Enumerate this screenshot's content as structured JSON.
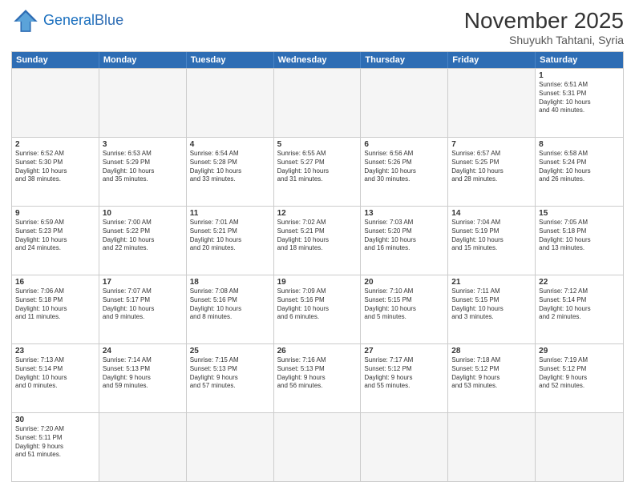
{
  "header": {
    "logo_general": "General",
    "logo_blue": "Blue",
    "month_title": "November 2025",
    "subtitle": "Shuyukh Tahtani, Syria"
  },
  "weekdays": [
    "Sunday",
    "Monday",
    "Tuesday",
    "Wednesday",
    "Thursday",
    "Friday",
    "Saturday"
  ],
  "rows": [
    [
      {
        "day": "",
        "info": ""
      },
      {
        "day": "",
        "info": ""
      },
      {
        "day": "",
        "info": ""
      },
      {
        "day": "",
        "info": ""
      },
      {
        "day": "",
        "info": ""
      },
      {
        "day": "",
        "info": ""
      },
      {
        "day": "1",
        "info": "Sunrise: 6:51 AM\nSunset: 5:31 PM\nDaylight: 10 hours\nand 40 minutes."
      }
    ],
    [
      {
        "day": "2",
        "info": "Sunrise: 6:52 AM\nSunset: 5:30 PM\nDaylight: 10 hours\nand 38 minutes."
      },
      {
        "day": "3",
        "info": "Sunrise: 6:53 AM\nSunset: 5:29 PM\nDaylight: 10 hours\nand 35 minutes."
      },
      {
        "day": "4",
        "info": "Sunrise: 6:54 AM\nSunset: 5:28 PM\nDaylight: 10 hours\nand 33 minutes."
      },
      {
        "day": "5",
        "info": "Sunrise: 6:55 AM\nSunset: 5:27 PM\nDaylight: 10 hours\nand 31 minutes."
      },
      {
        "day": "6",
        "info": "Sunrise: 6:56 AM\nSunset: 5:26 PM\nDaylight: 10 hours\nand 30 minutes."
      },
      {
        "day": "7",
        "info": "Sunrise: 6:57 AM\nSunset: 5:25 PM\nDaylight: 10 hours\nand 28 minutes."
      },
      {
        "day": "8",
        "info": "Sunrise: 6:58 AM\nSunset: 5:24 PM\nDaylight: 10 hours\nand 26 minutes."
      }
    ],
    [
      {
        "day": "9",
        "info": "Sunrise: 6:59 AM\nSunset: 5:23 PM\nDaylight: 10 hours\nand 24 minutes."
      },
      {
        "day": "10",
        "info": "Sunrise: 7:00 AM\nSunset: 5:22 PM\nDaylight: 10 hours\nand 22 minutes."
      },
      {
        "day": "11",
        "info": "Sunrise: 7:01 AM\nSunset: 5:21 PM\nDaylight: 10 hours\nand 20 minutes."
      },
      {
        "day": "12",
        "info": "Sunrise: 7:02 AM\nSunset: 5:21 PM\nDaylight: 10 hours\nand 18 minutes."
      },
      {
        "day": "13",
        "info": "Sunrise: 7:03 AM\nSunset: 5:20 PM\nDaylight: 10 hours\nand 16 minutes."
      },
      {
        "day": "14",
        "info": "Sunrise: 7:04 AM\nSunset: 5:19 PM\nDaylight: 10 hours\nand 15 minutes."
      },
      {
        "day": "15",
        "info": "Sunrise: 7:05 AM\nSunset: 5:18 PM\nDaylight: 10 hours\nand 13 minutes."
      }
    ],
    [
      {
        "day": "16",
        "info": "Sunrise: 7:06 AM\nSunset: 5:18 PM\nDaylight: 10 hours\nand 11 minutes."
      },
      {
        "day": "17",
        "info": "Sunrise: 7:07 AM\nSunset: 5:17 PM\nDaylight: 10 hours\nand 9 minutes."
      },
      {
        "day": "18",
        "info": "Sunrise: 7:08 AM\nSunset: 5:16 PM\nDaylight: 10 hours\nand 8 minutes."
      },
      {
        "day": "19",
        "info": "Sunrise: 7:09 AM\nSunset: 5:16 PM\nDaylight: 10 hours\nand 6 minutes."
      },
      {
        "day": "20",
        "info": "Sunrise: 7:10 AM\nSunset: 5:15 PM\nDaylight: 10 hours\nand 5 minutes."
      },
      {
        "day": "21",
        "info": "Sunrise: 7:11 AM\nSunset: 5:15 PM\nDaylight: 10 hours\nand 3 minutes."
      },
      {
        "day": "22",
        "info": "Sunrise: 7:12 AM\nSunset: 5:14 PM\nDaylight: 10 hours\nand 2 minutes."
      }
    ],
    [
      {
        "day": "23",
        "info": "Sunrise: 7:13 AM\nSunset: 5:14 PM\nDaylight: 10 hours\nand 0 minutes."
      },
      {
        "day": "24",
        "info": "Sunrise: 7:14 AM\nSunset: 5:13 PM\nDaylight: 9 hours\nand 59 minutes."
      },
      {
        "day": "25",
        "info": "Sunrise: 7:15 AM\nSunset: 5:13 PM\nDaylight: 9 hours\nand 57 minutes."
      },
      {
        "day": "26",
        "info": "Sunrise: 7:16 AM\nSunset: 5:13 PM\nDaylight: 9 hours\nand 56 minutes."
      },
      {
        "day": "27",
        "info": "Sunrise: 7:17 AM\nSunset: 5:12 PM\nDaylight: 9 hours\nand 55 minutes."
      },
      {
        "day": "28",
        "info": "Sunrise: 7:18 AM\nSunset: 5:12 PM\nDaylight: 9 hours\nand 53 minutes."
      },
      {
        "day": "29",
        "info": "Sunrise: 7:19 AM\nSunset: 5:12 PM\nDaylight: 9 hours\nand 52 minutes."
      }
    ],
    [
      {
        "day": "30",
        "info": "Sunrise: 7:20 AM\nSunset: 5:11 PM\nDaylight: 9 hours\nand 51 minutes."
      },
      {
        "day": "",
        "info": ""
      },
      {
        "day": "",
        "info": ""
      },
      {
        "day": "",
        "info": ""
      },
      {
        "day": "",
        "info": ""
      },
      {
        "day": "",
        "info": ""
      },
      {
        "day": "",
        "info": ""
      }
    ]
  ]
}
